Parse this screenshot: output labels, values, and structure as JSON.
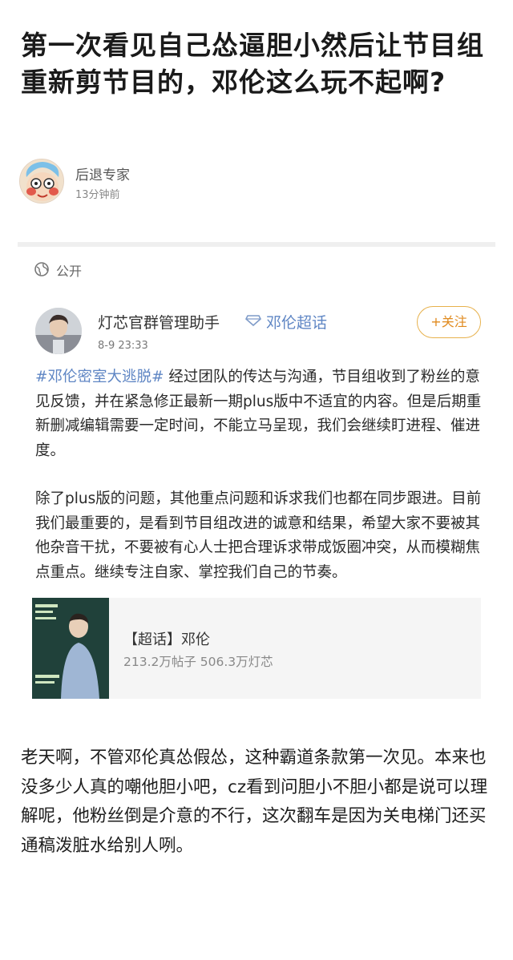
{
  "article": {
    "title": "第一次看见自己怂逼胆小然后让节目组重新剪节目的，邓伦这么玩不起啊?",
    "author_name": "后退专家",
    "author_time": "13分钟前"
  },
  "visibility": {
    "label": "公开",
    "icon": "globe-icon"
  },
  "post": {
    "user": "灯芯官群管理助手",
    "topic_icon": "diamond-icon",
    "topic": "邓伦超话",
    "date": "8-9 23:33",
    "follow_label": "+关注",
    "hashtag": "#邓伦密室大逃脱#",
    "paragraph1_rest": " 经过团队的传达与沟通，节目组收到了粉丝的意见反馈，并在紧急修正最新一期plus版中不适宜的内容。但是后期重新删减编辑需要一定时间，不能立马呈现，我们会继续盯进程、催进度。",
    "paragraph2": "除了plus版的问题，其他重点问题和诉求我们也都在同步跟进。目前我们最重要的，是看到节目组改进的诚意和结果，希望大家不要被其他杂音干扰，不要被有心人士把合理诉求带成饭圈冲突，从而模糊焦点重点。继续专注自家、掌控我们自己的节奏。"
  },
  "card": {
    "title": "【超话】邓伦",
    "stats": "213.2万帖子 506.3万灯芯"
  },
  "comment": {
    "text": "老天啊，不管邓伦真怂假怂，这种霸道条款第一次见。本来也没多少人真的嘲他胆小吧，cz看到问胆小不胆小都是说可以理解呢，他粉丝倒是介意的不行，这次翻车是因为关电梯门还买通稿泼脏水给别人咧。"
  },
  "colors": {
    "link": "#5f86c4",
    "follow_border": "#e7b14c",
    "follow_text": "#e08a1e",
    "divider": "#efefef"
  }
}
